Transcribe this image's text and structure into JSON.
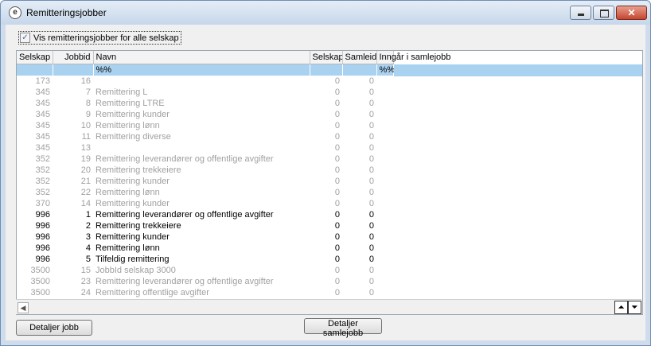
{
  "window": {
    "title": "Remitteringsjobber"
  },
  "checkbox": {
    "label": "Vis remitteringsjobber for alle selskap",
    "checked": true
  },
  "table": {
    "columns": [
      "Selskap",
      "Jobbid",
      "Navn",
      "Selskap",
      "Samleid",
      "Inngår i samlejobb"
    ],
    "filter": {
      "navn": "%%",
      "inngar": "%%"
    },
    "rows": [
      {
        "selskap": "173",
        "jobbid": "16",
        "navn": "",
        "selskap2": "0",
        "samleid": "0",
        "inngar": "",
        "grey": true
      },
      {
        "selskap": "345",
        "jobbid": "7",
        "navn": "Remittering L",
        "selskap2": "0",
        "samleid": "0",
        "inngar": "",
        "grey": true
      },
      {
        "selskap": "345",
        "jobbid": "8",
        "navn": "Remittering LTRE",
        "selskap2": "0",
        "samleid": "0",
        "inngar": "",
        "grey": true
      },
      {
        "selskap": "345",
        "jobbid": "9",
        "navn": "Remittering kunder",
        "selskap2": "0",
        "samleid": "0",
        "inngar": "",
        "grey": true
      },
      {
        "selskap": "345",
        "jobbid": "10",
        "navn": "Remittering lønn",
        "selskap2": "0",
        "samleid": "0",
        "inngar": "",
        "grey": true
      },
      {
        "selskap": "345",
        "jobbid": "11",
        "navn": "Remittering diverse",
        "selskap2": "0",
        "samleid": "0",
        "inngar": "",
        "grey": true
      },
      {
        "selskap": "345",
        "jobbid": "13",
        "navn": "",
        "selskap2": "0",
        "samleid": "0",
        "inngar": "",
        "grey": true
      },
      {
        "selskap": "352",
        "jobbid": "19",
        "navn": "Remittering leverandører og offentlige avgifter",
        "selskap2": "0",
        "samleid": "0",
        "inngar": "",
        "grey": true
      },
      {
        "selskap": "352",
        "jobbid": "20",
        "navn": "Remittering trekkeiere",
        "selskap2": "0",
        "samleid": "0",
        "inngar": "",
        "grey": true
      },
      {
        "selskap": "352",
        "jobbid": "21",
        "navn": "Remittering kunder",
        "selskap2": "0",
        "samleid": "0",
        "inngar": "",
        "grey": true
      },
      {
        "selskap": "352",
        "jobbid": "22",
        "navn": "Remittering lønn",
        "selskap2": "0",
        "samleid": "0",
        "inngar": "",
        "grey": true
      },
      {
        "selskap": "370",
        "jobbid": "14",
        "navn": "Remittering kunder",
        "selskap2": "0",
        "samleid": "0",
        "inngar": "",
        "grey": true
      },
      {
        "selskap": "996",
        "jobbid": "1",
        "navn": "Remittering leverandører og offentlige avgifter",
        "selskap2": "0",
        "samleid": "0",
        "inngar": "",
        "grey": false
      },
      {
        "selskap": "996",
        "jobbid": "2",
        "navn": "Remittering trekkeiere",
        "selskap2": "0",
        "samleid": "0",
        "inngar": "",
        "grey": false
      },
      {
        "selskap": "996",
        "jobbid": "3",
        "navn": "Remittering kunder",
        "selskap2": "0",
        "samleid": "0",
        "inngar": "",
        "grey": false
      },
      {
        "selskap": "996",
        "jobbid": "4",
        "navn": "Remittering lønn",
        "selskap2": "0",
        "samleid": "0",
        "inngar": "",
        "grey": false
      },
      {
        "selskap": "996",
        "jobbid": "5",
        "navn": "Tilfeldig remittering",
        "selskap2": "0",
        "samleid": "0",
        "inngar": "",
        "grey": false
      },
      {
        "selskap": "3500",
        "jobbid": "15",
        "navn": "JobbId selskap 3000",
        "selskap2": "0",
        "samleid": "0",
        "inngar": "",
        "grey": true
      },
      {
        "selskap": "3500",
        "jobbid": "23",
        "navn": "Remittering leverandører og offentlige avgifter",
        "selskap2": "0",
        "samleid": "0",
        "inngar": "",
        "grey": true
      },
      {
        "selskap": "3500",
        "jobbid": "24",
        "navn": "Remittering offentlige avgifter",
        "selskap2": "0",
        "samleid": "0",
        "inngar": "",
        "grey": true
      }
    ]
  },
  "buttons": {
    "details_job": "Detaljer jobb",
    "details_collective": "Detaljer samlejobb"
  }
}
